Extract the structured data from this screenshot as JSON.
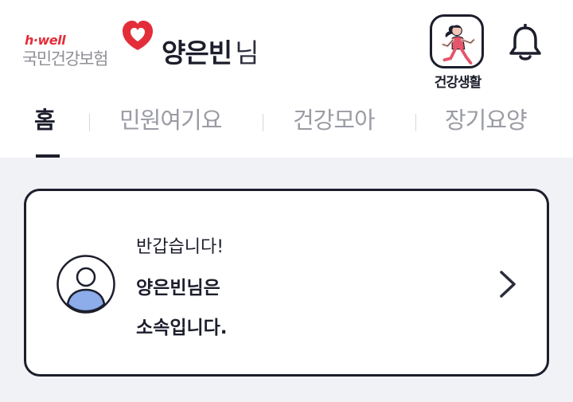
{
  "header": {
    "logo_tagline": "h·well",
    "logo_name": "국민건강보험",
    "user_name": "양은빈",
    "user_suffix": "님",
    "health_life_label": "건강생활"
  },
  "tabs": [
    {
      "label": "홈",
      "active": true
    },
    {
      "label": "민원여기요",
      "active": false
    },
    {
      "label": "건강모아",
      "active": false
    },
    {
      "label": "장기요양",
      "active": false
    }
  ],
  "card": {
    "greeting": "반갑습니다!",
    "line_name": "양은빈님은",
    "line_affiliation": "소속입니다."
  },
  "colors": {
    "accent": "#e32e3a",
    "text_primary": "#1c1e2c",
    "text_muted": "#9a9ba3",
    "background": "#f1f2f6",
    "avatar_blue": "#8cacea"
  },
  "icons": {
    "logo": "heart-logo-icon",
    "health_life": "runner-icon",
    "notification": "bell-icon",
    "avatar": "user-avatar-icon",
    "card_arrow": "chevron-right-icon"
  }
}
